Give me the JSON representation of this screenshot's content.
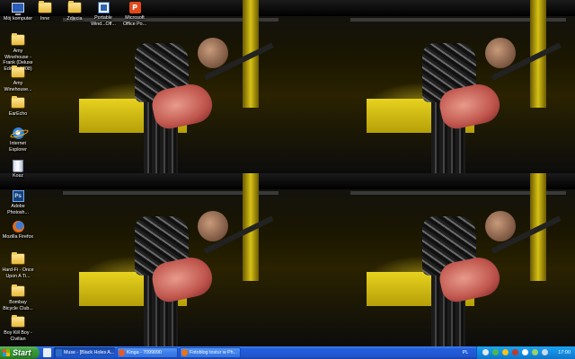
{
  "desktop": {
    "icons": [
      {
        "label": "Mój komputer",
        "icon": "my-computer-icon"
      },
      {
        "label": "Inne",
        "icon": "folder-icon"
      },
      {
        "label": "Zdjęcia",
        "icon": "folder-icon"
      },
      {
        "label": "Portable\nWind...Off...",
        "icon": "portable-app-icon"
      },
      {
        "label": "Microsoft\nOffice Po...",
        "icon": "office-icon"
      },
      {
        "label": "Amy\nWinehouse -\nFrank (Deluxe\nEdition 2008)",
        "icon": "folder-icon"
      },
      {
        "label": "Amy\nWinehouse...",
        "icon": "folder-icon"
      },
      {
        "label": "EarEcho",
        "icon": "folder-icon"
      },
      {
        "label": "Internet\nExplorer",
        "icon": "internet-explorer-icon"
      },
      {
        "label": "Kosz",
        "icon": "recycle-bin-icon"
      },
      {
        "label": "Adobe\nPhotosh...",
        "icon": "photoshop-icon"
      },
      {
        "label": "Mozilla Firefox",
        "icon": "firefox-icon"
      },
      {
        "label": "Hard-Fi - Once\nUpon A Ti...",
        "icon": "folder-icon"
      },
      {
        "label": "Bombay\nBicycle Club...",
        "icon": "folder-icon"
      },
      {
        "label": "Boy Kill Boy -\nCivilian",
        "icon": "folder-icon"
      }
    ]
  },
  "taskbar": {
    "start_label": "Start",
    "tasks": [
      {
        "label": "Muse - [Black Holes A...",
        "icon": "media-player-icon",
        "active": true
      },
      {
        "label": "Kinga - 7099090",
        "icon": "messenger-icon",
        "active": false
      },
      {
        "label": "Fotoblog tostur w Ph...",
        "icon": "firefox-icon",
        "active": false
      }
    ],
    "language": "PL",
    "clock": "17:00"
  },
  "colors": {
    "taskbar_blue": "#245edb",
    "start_green": "#3a9a3a",
    "tray_blue": "#138ce0",
    "stage_yellow": "#d9c21a"
  }
}
